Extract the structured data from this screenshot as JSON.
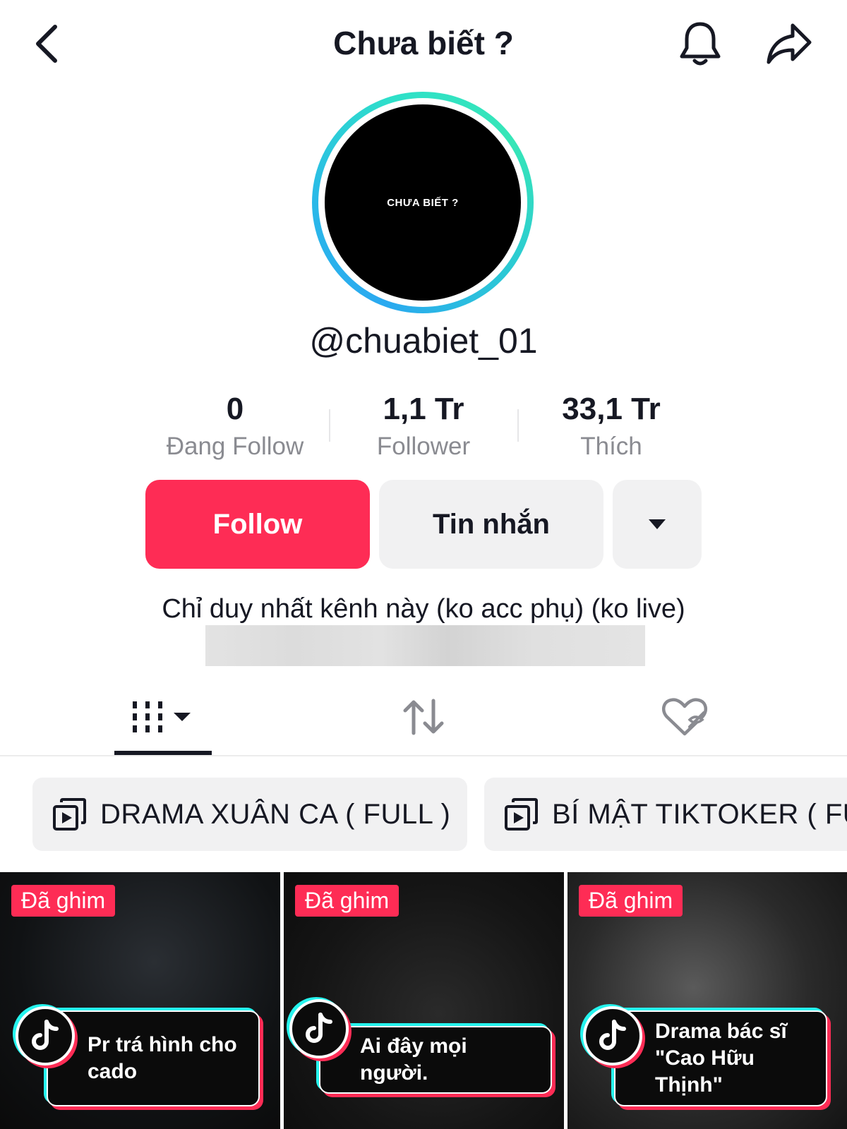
{
  "header": {
    "title": "Chưa biết ?"
  },
  "profile": {
    "avatar_text": "CHƯA BIẾT ?",
    "username": "@chuabiet_01",
    "bio": "Chỉ duy nhất kênh này (ko acc phụ) (ko live)"
  },
  "stats": [
    {
      "value": "0",
      "label": "Đang Follow"
    },
    {
      "value": "1,1 Tr",
      "label": "Follower"
    },
    {
      "value": "33,1 Tr",
      "label": "Thích"
    }
  ],
  "actions": {
    "follow_label": "Follow",
    "message_label": "Tin nhắn"
  },
  "playlists": [
    {
      "label": "DRAMA XUÂN CA ( FULL )"
    },
    {
      "label": "BÍ MẬT TIKTOKER ( FU"
    }
  ],
  "videos": [
    {
      "badge": "Đã ghim",
      "caption": "Pr trá hình cho cado"
    },
    {
      "badge": "Đã ghim",
      "caption": "Ai đây mọi người."
    },
    {
      "badge": "Đã ghim",
      "caption": "Drama bác sĩ \"Cao Hữu Thịnh\""
    }
  ],
  "icons": {
    "back": "chevron-left-icon",
    "bell": "bell-icon",
    "share": "share-arrow-icon",
    "dropdown": "caret-down-icon",
    "videos_tab": "grid-icon",
    "reposts_tab": "repost-icon",
    "liked_tab": "liked-hidden-icon",
    "playlist": "playlist-icon",
    "tiktok": "tiktok-logo-icon"
  },
  "colors": {
    "accent": "#fe2c55",
    "cyan": "#25f4ee",
    "button_secondary": "#f1f1f2",
    "text_primary": "#161823",
    "text_secondary": "#8a8b91"
  }
}
